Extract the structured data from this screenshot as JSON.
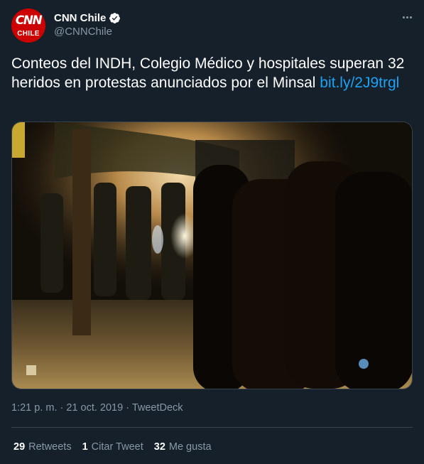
{
  "account": {
    "display_name": "CNN Chile",
    "handle": "@CNNChile",
    "verified": true,
    "avatar_logo_top": "CNN",
    "avatar_logo_bottom": "CHILE"
  },
  "tweet": {
    "text": "Conteos del INDH, Colegio Médico y hospitales superan 32 heridos en protestas anunciados por el Minsal",
    "link_text": "bit.ly/2J9trgl",
    "media": {
      "icon": "photo",
      "alt": ""
    },
    "timestamp": "1:21 p. m. · 21 oct. 2019",
    "separator": " · ",
    "source": "TweetDeck"
  },
  "stats": {
    "retweets_count": "29",
    "retweets_label": "Retweets",
    "quotes_count": "1",
    "quotes_label": "Citar Tweet",
    "likes_count": "32",
    "likes_label": "Me gusta"
  },
  "colors": {
    "background": "#15202b",
    "link": "#1da1f2",
    "secondary_text": "#8899a6",
    "divider": "#38444d",
    "avatar_red": "#cc0000"
  }
}
